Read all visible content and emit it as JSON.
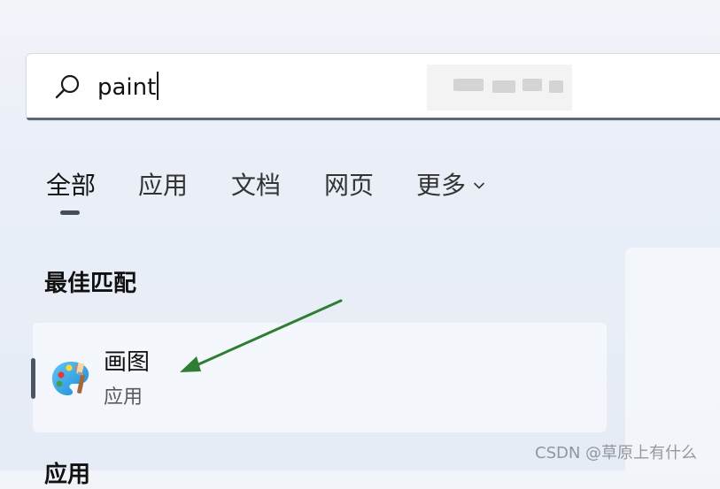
{
  "search": {
    "icon": "search-icon",
    "value": "paint"
  },
  "tabs": [
    {
      "label": "全部",
      "active": true
    },
    {
      "label": "应用",
      "active": false
    },
    {
      "label": "文档",
      "active": false
    },
    {
      "label": "网页",
      "active": false
    },
    {
      "label": "更多",
      "active": false,
      "icon": "chevron-down-icon"
    }
  ],
  "best_match": {
    "section_title": "最佳匹配",
    "item": {
      "icon": "paint-palette-icon",
      "name": "画图",
      "type": "应用"
    }
  },
  "next_section": {
    "title": "应用"
  },
  "annotation": {
    "arrow_color": "#2e7d32"
  },
  "watermark": "CSDN @草原上有什么"
}
